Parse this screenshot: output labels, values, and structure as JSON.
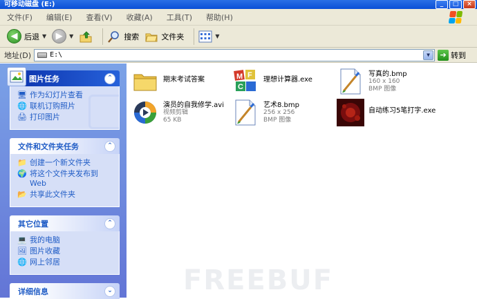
{
  "window": {
    "title": "可移动磁盘 (E:)",
    "buttons": {
      "minimize": "_",
      "maximize": "□",
      "close": "×"
    }
  },
  "menu": [
    "文件(F)",
    "编辑(E)",
    "查看(V)",
    "收藏(A)",
    "工具(T)",
    "帮助(H)"
  ],
  "toolbar": {
    "back_label": "后退",
    "search_label": "搜索",
    "folders_label": "文件夹"
  },
  "address": {
    "label": "地址(D)",
    "value": "E:\\",
    "go_label": "转到"
  },
  "taskpane": {
    "picture_tasks": {
      "title": "图片任务",
      "items": [
        "作为幻灯片查看",
        "联机订购照片",
        "打印图片"
      ]
    },
    "file_folder_tasks": {
      "title": "文件和文件夹任务",
      "items": [
        "创建一个新文件夹",
        "将这个文件夹发布到 Web",
        "共享此文件夹"
      ]
    },
    "other_places": {
      "title": "其它位置",
      "items": [
        "我的电脑",
        "图片收藏",
        "网上邻居"
      ]
    },
    "details": {
      "title": "详细信息"
    }
  },
  "files": [
    {
      "name": "期末考试答案",
      "meta1": "",
      "meta2": "",
      "icon": "folder-icon"
    },
    {
      "name": "理想计算器.exe",
      "meta1": "",
      "meta2": "",
      "icon": "mfc-app-icon"
    },
    {
      "name": "写真的.bmp",
      "meta1": "160 x 160",
      "meta2": "BMP 图像",
      "icon": "bmp-image-icon"
    },
    {
      "name": "演员的自我修学.avi",
      "meta1": "视频剪辑",
      "meta2": "65 KB",
      "icon": "media-player-icon"
    },
    {
      "name": "艺术8.bmp",
      "meta1": "256 x 256",
      "meta2": "BMP 图像",
      "icon": "bmp-image-icon"
    },
    {
      "name": "自动练习5笔打字.exe",
      "meta1": "",
      "meta2": "",
      "icon": "red-app-icon"
    }
  ],
  "watermark": "FREEBUF",
  "colors": {
    "taskpane_top": "#7ba2e7",
    "taskpane_bottom": "#6375d6",
    "link": "#215dc6",
    "titlebar": "#0a4fd6"
  }
}
